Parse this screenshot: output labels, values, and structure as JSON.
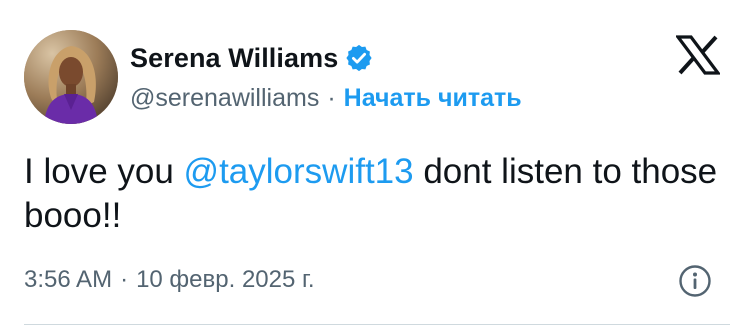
{
  "tweet": {
    "author": {
      "display_name": "Serena Williams",
      "handle": "@serenawilliams",
      "verified": true,
      "verified_icon": "verified-badge-icon",
      "avatar_icon": "avatar-photo"
    },
    "separator": "·",
    "follow_label": "Начать читать",
    "text_before": "I love you ",
    "mention": "@taylorswift13",
    "text_after": " dont listen to those booo!!",
    "time": "3:56 AM",
    "date": "10 февр. 2025 г.",
    "info_icon": "info-icon",
    "platform_icon": "x-logo-icon"
  },
  "colors": {
    "link": "#1d9bf0",
    "secondary_text": "#536471",
    "primary_text": "#0f1419",
    "divider": "#cfd9de"
  }
}
